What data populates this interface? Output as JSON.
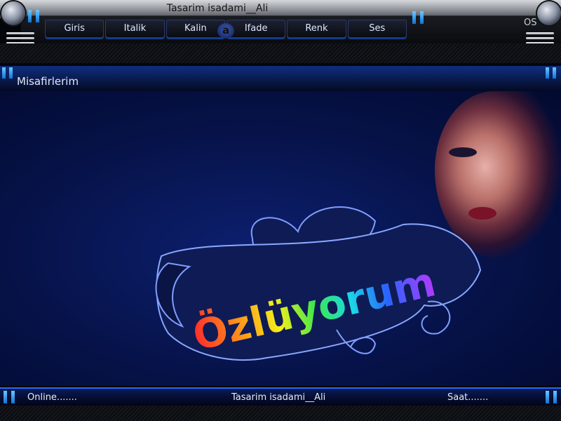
{
  "window": {
    "title": "Tasarim isadami__Ali",
    "corner_label": "OS"
  },
  "menu": {
    "items": [
      {
        "label": "Giris"
      },
      {
        "label": "Italik"
      },
      {
        "label": "Kalin"
      },
      {
        "label": "Ifade"
      },
      {
        "label": "Renk"
      },
      {
        "label": "Ses"
      }
    ],
    "logo": "a"
  },
  "header": {
    "title": "Misafirlerim"
  },
  "content": {
    "banner_text": "Özlüyorum"
  },
  "footer": {
    "left": "Online.......",
    "center": "Tasarim isadami__Ali",
    "right": "Saat......."
  },
  "colors": {
    "accent": "#1f6cff",
    "background": "#061248",
    "ribbon": "#0f1b55"
  }
}
